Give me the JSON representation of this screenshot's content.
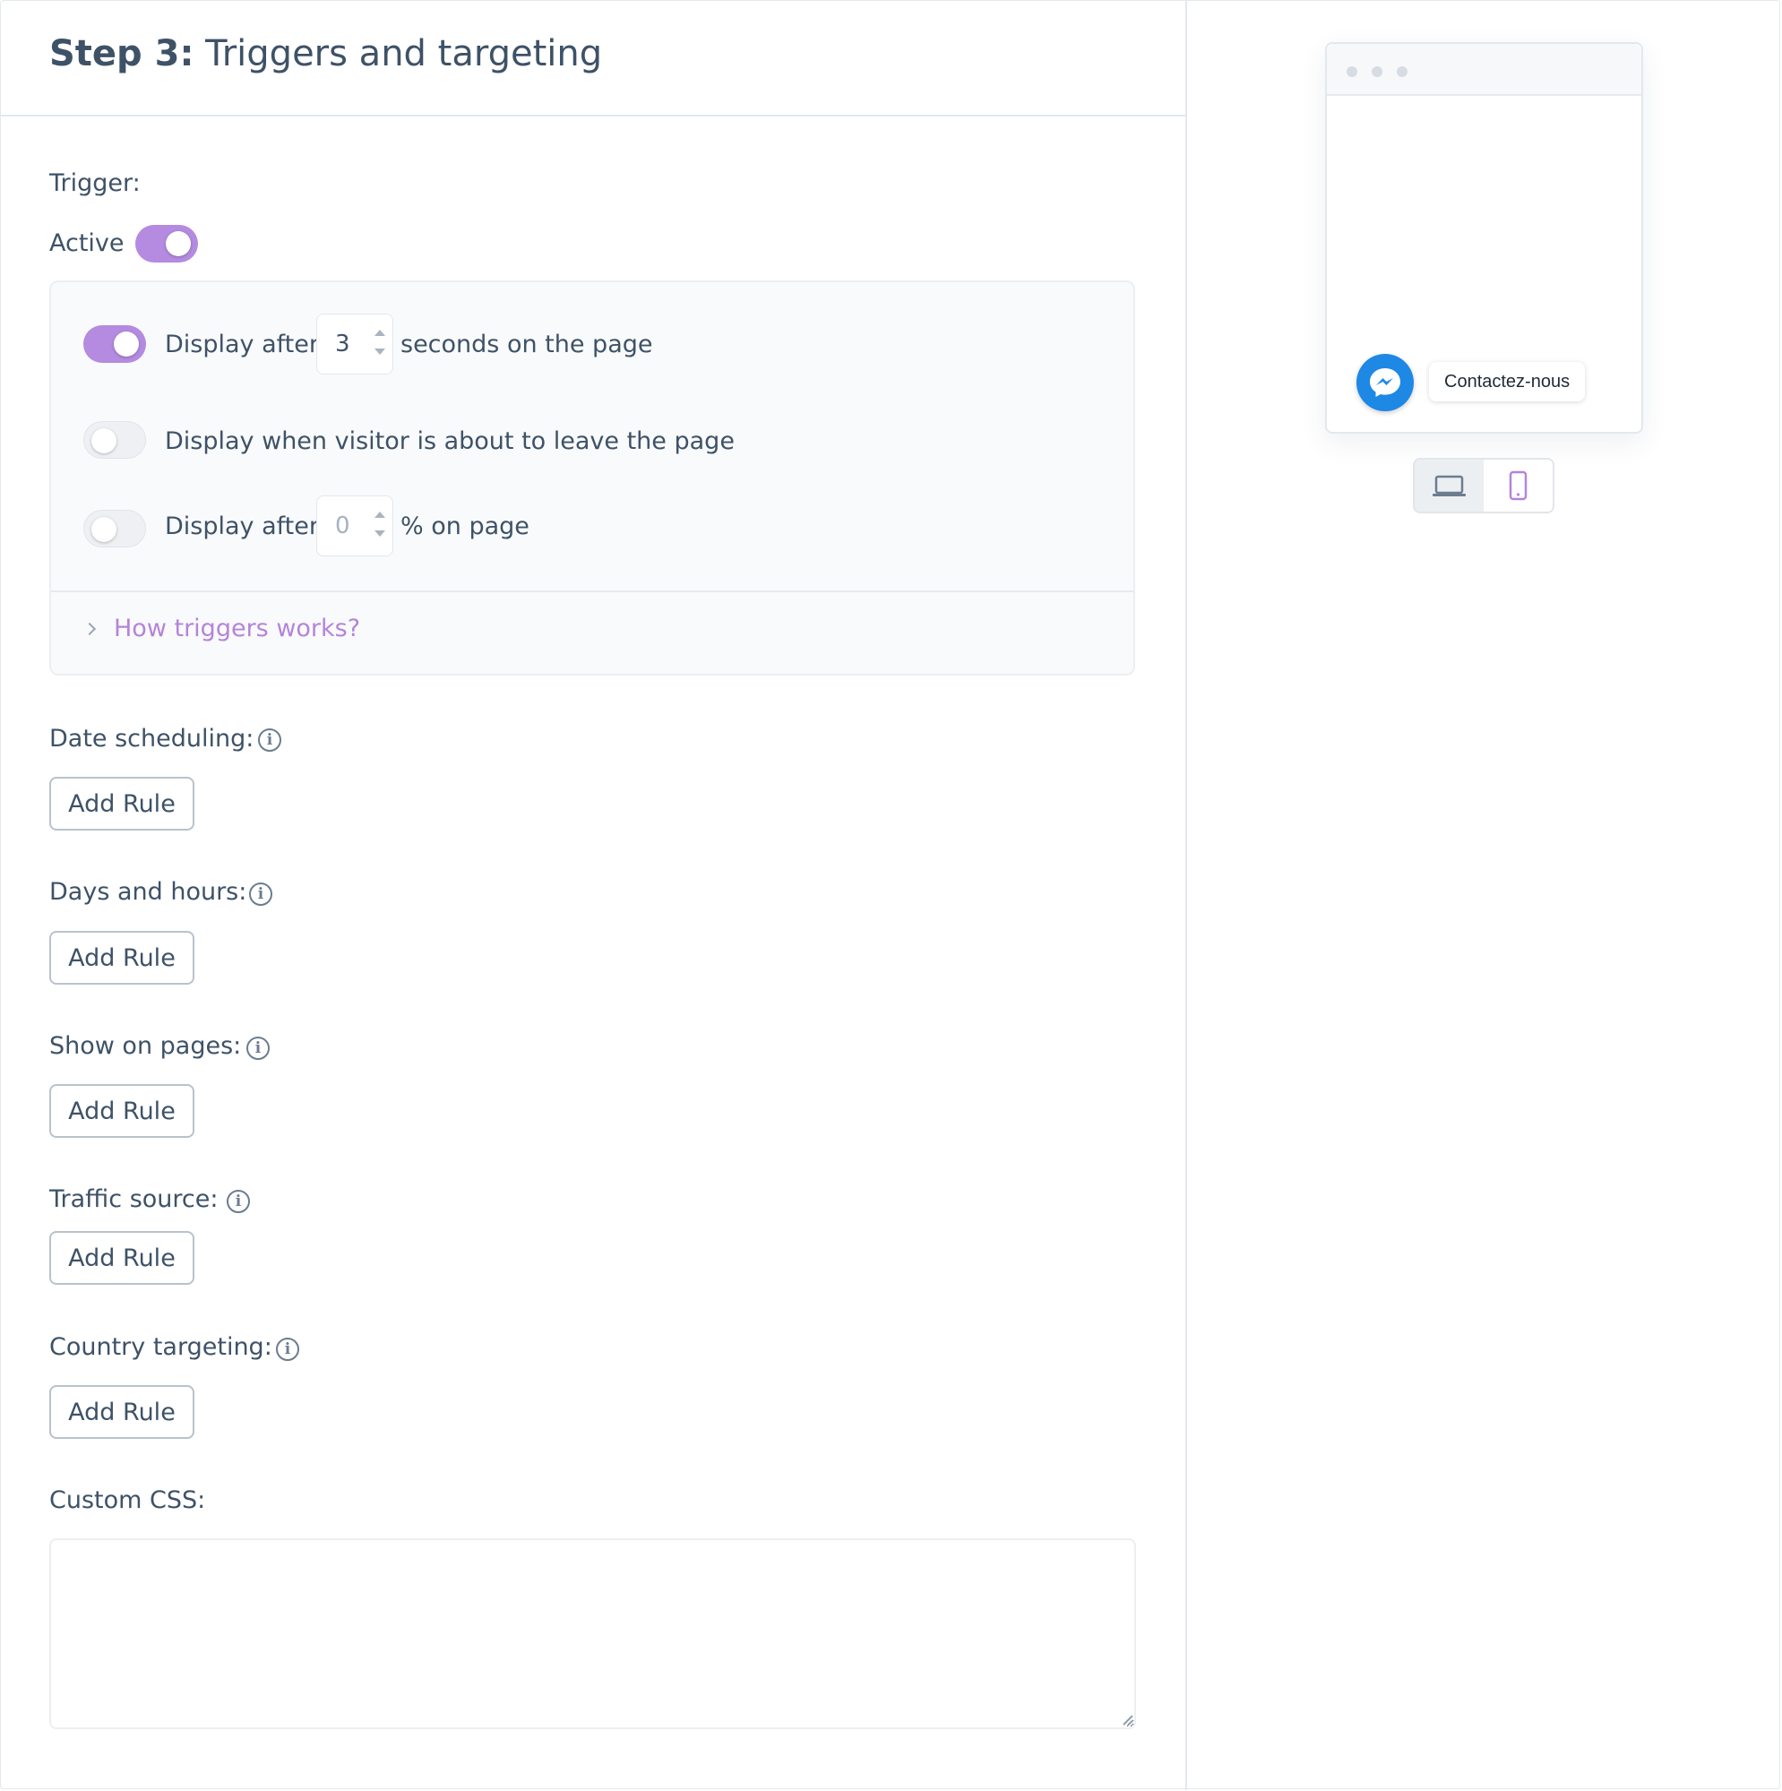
{
  "header": {
    "step_label": "Step 3:",
    "title": "Triggers and targeting"
  },
  "trigger": {
    "label": "Trigger:",
    "active_label": "Active",
    "active": true,
    "rows": [
      {
        "enabled": true,
        "prefix": "Display after",
        "value": "3",
        "suffix": "seconds on the page"
      },
      {
        "enabled": false,
        "text": "Display when visitor is about to leave the page"
      },
      {
        "enabled": false,
        "prefix": "Display after",
        "value": "0",
        "suffix": "% on page"
      }
    ],
    "help_link": "How triggers works?"
  },
  "sections": [
    {
      "label": "Date scheduling:",
      "button": "Add Rule"
    },
    {
      "label": "Days and hours:",
      "button": "Add Rule"
    },
    {
      "label": "Show on pages:",
      "button": "Add Rule"
    },
    {
      "label": "Traffic source:",
      "button": "Add Rule"
    },
    {
      "label": "Country targeting:",
      "button": "Add Rule"
    }
  ],
  "custom_css": {
    "label": "Custom CSS:",
    "value": ""
  },
  "preview": {
    "widget_label": "Contactez-nous",
    "widget_icon": "messenger-icon",
    "device_options": [
      "desktop",
      "mobile"
    ],
    "selected_device": "mobile"
  },
  "colors": {
    "accent": "#b48be0",
    "link": "#b484d9",
    "messenger": "#1e88e5",
    "text": "#3e5267"
  }
}
